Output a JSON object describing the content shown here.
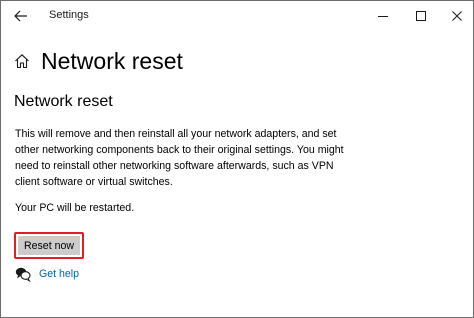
{
  "window": {
    "title": "Settings"
  },
  "caption": {
    "back_icon": "back-arrow-icon",
    "minimize_icon": "minimize-icon",
    "maximize_icon": "maximize-icon",
    "close_icon": "close-icon"
  },
  "page": {
    "title": "Network reset",
    "home_icon": "home-icon"
  },
  "section": {
    "title": "Network reset",
    "description": "This will remove and then reinstall all your network adapters, and set other networking components back to their original settings. You might need to reinstall other networking software afterwards, such as VPN client software or virtual switches.",
    "restart_note": "Your PC will be restarted."
  },
  "actions": {
    "reset_label": "Reset now",
    "highlight_color": "#e02020"
  },
  "help": {
    "icon": "chat-help-icon",
    "label": "Get help",
    "link_color": "#0066b4"
  }
}
